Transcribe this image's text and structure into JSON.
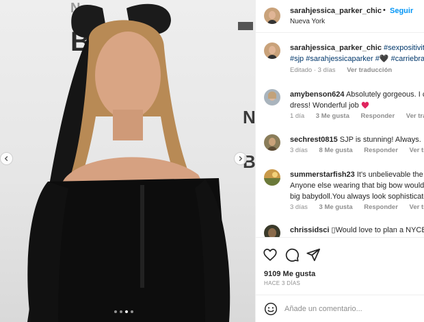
{
  "post": {
    "username": "sarahjessica_parker_chic",
    "follow_label": "Seguir",
    "separator": "•",
    "location": "Nueva York"
  },
  "caption": {
    "username": "sarahjessica_parker_chic",
    "line1_tag": "#sexpositivity",
    "line1_tag_extra": "#",
    "line2": "#sjp #sarahjessicaparker #🖤 #carriebradshaw",
    "meta_edited": "Editado · 3 días",
    "meta_translation": "Ver traducción"
  },
  "comments": [
    {
      "username": "amybenson624",
      "line1": "Absolutely gorgeous. I c",
      "line2": "dress! Wonderful job",
      "time": "1 día",
      "likes": "3 Me gusta",
      "reply": "Responder",
      "translation": "Ver traducción"
    },
    {
      "username": "sechrest0815",
      "line1": "SJP is stunning! Always.",
      "time": "3 días",
      "likes": "8 Me gusta",
      "reply": "Responder",
      "translation": "Ver traducción"
    },
    {
      "username": "summerstarfish23",
      "line1": "It's unbelievable the l",
      "line2": "Anyone else wearing that big bow would",
      "line3": "big babydoll.You always look sophisticate",
      "time": "3 días",
      "likes": "3 Me gusta",
      "reply": "Responder",
      "translation": "Ver traducción"
    },
    {
      "username": "chrissidsci",
      "line1": "▯Would love to plan a NYCB l"
    }
  ],
  "actions": {
    "likes": "9109 Me gusta",
    "date": "HACE 3 DÍAS"
  },
  "add_comment": {
    "placeholder": "Añade un comentario..."
  },
  "icons": {
    "like": "heart-outline-icon",
    "comment": "comment-bubble-icon",
    "share": "paper-plane-icon",
    "emoji": "smiley-face-icon",
    "prev": "chevron-left-icon",
    "next": "chevron-right-icon"
  },
  "colors": {
    "accent_blue": "#0095f6",
    "heart_red": "#ed4956",
    "text_secondary": "#8e8e8e"
  },
  "carousel": {
    "slide_count": 4,
    "active_index": 2
  }
}
